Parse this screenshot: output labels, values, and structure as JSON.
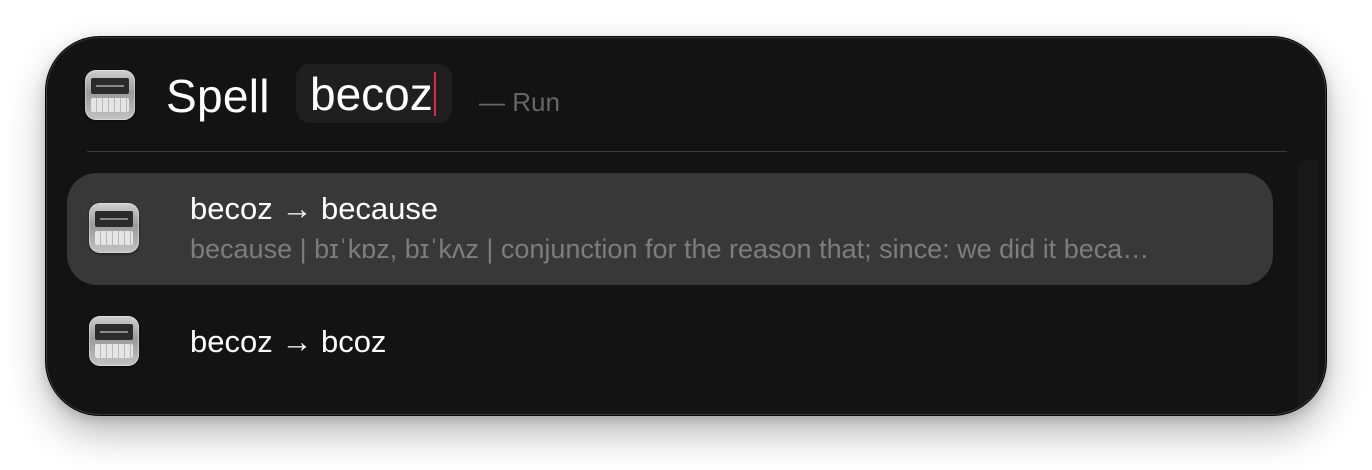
{
  "search": {
    "keyword": "Spell",
    "query": "becoz",
    "action_hint": "— Run",
    "icon": "keyboard-app-icon"
  },
  "results": [
    {
      "title": "becoz → because",
      "subtitle": "because | bɪˈkɒz, bɪˈkʌz | conjunction for the reason that; since: we did it beca…",
      "selected": true,
      "icon": "keyboard-app-icon"
    },
    {
      "title": "becoz → bcoz",
      "subtitle": "",
      "selected": false,
      "icon": "keyboard-app-icon"
    }
  ],
  "colors": {
    "window_background": "#131313",
    "selected_row": "#383838",
    "caret": "#e3234f",
    "secondary_text": "#7d7d7d"
  }
}
